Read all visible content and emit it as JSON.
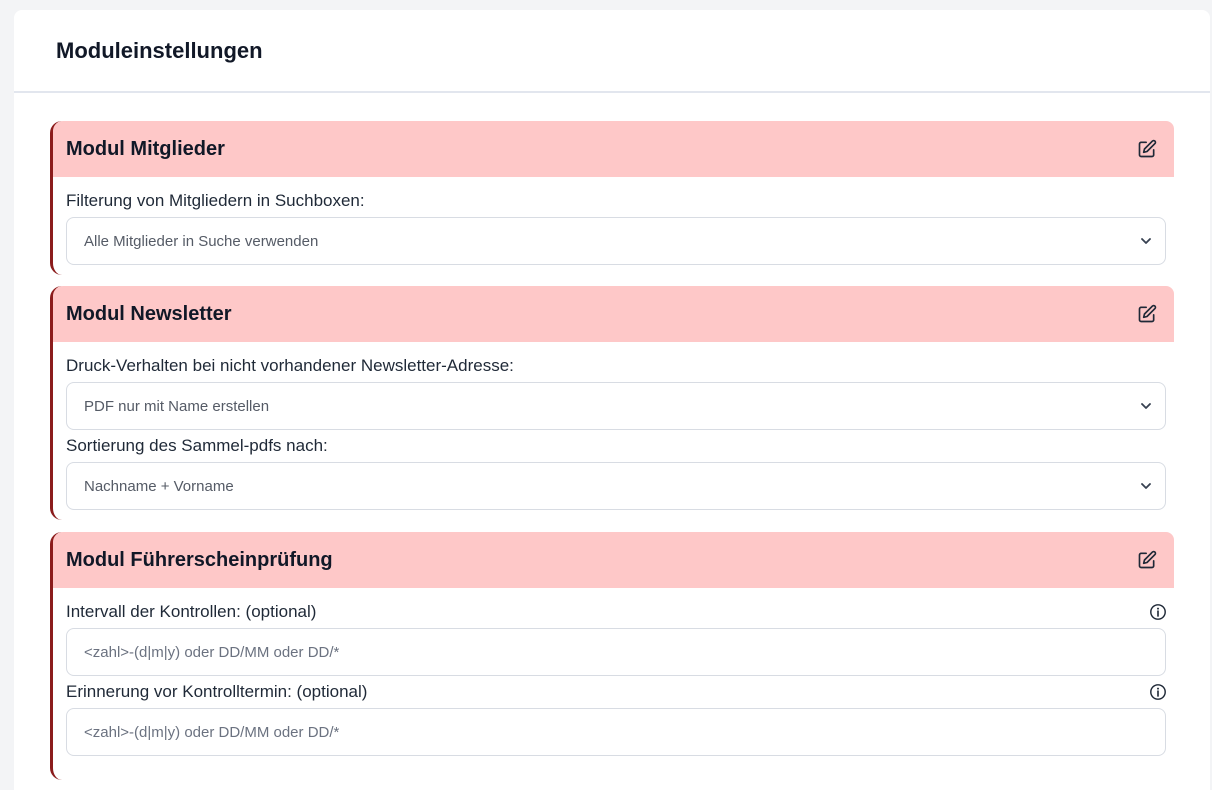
{
  "page": {
    "title": "Moduleinstellungen"
  },
  "modules": [
    {
      "title": "Modul Mitglieder",
      "fields": [
        {
          "label": "Filterung von Mitgliedern in Suchboxen:",
          "value": "Alle Mitglieder in Suche verwenden"
        }
      ]
    },
    {
      "title": "Modul Newsletter",
      "fields": [
        {
          "label": "Druck-Verhalten bei nicht vorhandener Newsletter-Adresse:",
          "value": "PDF nur mit Name erstellen"
        },
        {
          "label": "Sortierung des Sammel-pdfs nach:",
          "value": "Nachname + Vorname"
        }
      ]
    },
    {
      "title": "Modul Führerscheinprüfung",
      "fields": [
        {
          "label": "Intervall der Kontrollen: (optional)",
          "placeholder": "<zahl>-(d|m|y) oder DD/MM oder DD/*"
        },
        {
          "label": "Erinnerung vor Kontrolltermin: (optional)",
          "placeholder": "<zahl>-(d|m|y) oder DD/MM oder DD/*"
        }
      ]
    }
  ],
  "icons": {
    "edit": "pencil-square-icon",
    "dropdown": "chevron-down-icon",
    "info": "info-circle-icon"
  },
  "colors": {
    "module_header_bg": "#fec8c8",
    "module_accent_border": "#8b1c1c"
  }
}
